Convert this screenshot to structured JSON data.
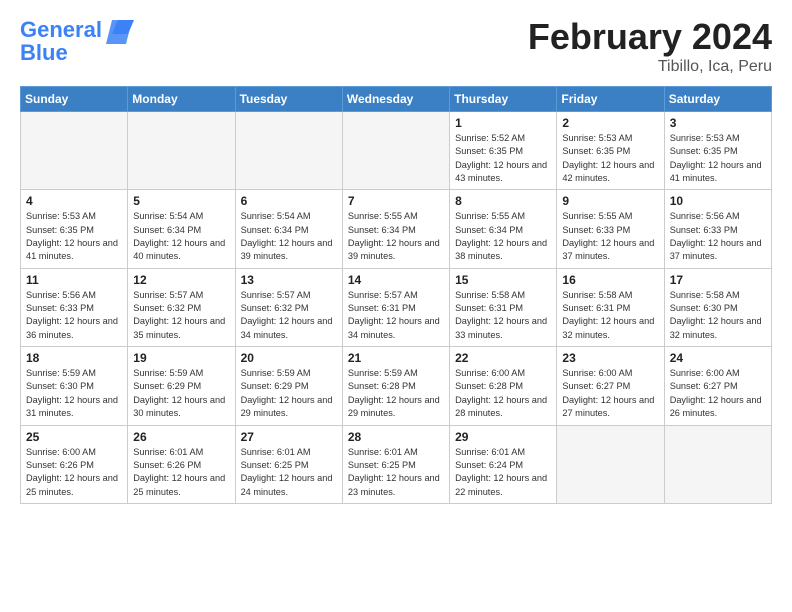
{
  "header": {
    "logo_general": "General",
    "logo_blue": "Blue",
    "month_title": "February 2024",
    "location": "Tibillo, Ica, Peru"
  },
  "days_of_week": [
    "Sunday",
    "Monday",
    "Tuesday",
    "Wednesday",
    "Thursday",
    "Friday",
    "Saturday"
  ],
  "weeks": [
    [
      {
        "num": "",
        "empty": true
      },
      {
        "num": "",
        "empty": true
      },
      {
        "num": "",
        "empty": true
      },
      {
        "num": "",
        "empty": true
      },
      {
        "num": "1",
        "sunrise": "5:52 AM",
        "sunset": "6:35 PM",
        "daylight": "12 hours and 43 minutes."
      },
      {
        "num": "2",
        "sunrise": "5:53 AM",
        "sunset": "6:35 PM",
        "daylight": "12 hours and 42 minutes."
      },
      {
        "num": "3",
        "sunrise": "5:53 AM",
        "sunset": "6:35 PM",
        "daylight": "12 hours and 41 minutes."
      }
    ],
    [
      {
        "num": "4",
        "sunrise": "5:53 AM",
        "sunset": "6:35 PM",
        "daylight": "12 hours and 41 minutes."
      },
      {
        "num": "5",
        "sunrise": "5:54 AM",
        "sunset": "6:34 PM",
        "daylight": "12 hours and 40 minutes."
      },
      {
        "num": "6",
        "sunrise": "5:54 AM",
        "sunset": "6:34 PM",
        "daylight": "12 hours and 39 minutes."
      },
      {
        "num": "7",
        "sunrise": "5:55 AM",
        "sunset": "6:34 PM",
        "daylight": "12 hours and 39 minutes."
      },
      {
        "num": "8",
        "sunrise": "5:55 AM",
        "sunset": "6:34 PM",
        "daylight": "12 hours and 38 minutes."
      },
      {
        "num": "9",
        "sunrise": "5:55 AM",
        "sunset": "6:33 PM",
        "daylight": "12 hours and 37 minutes."
      },
      {
        "num": "10",
        "sunrise": "5:56 AM",
        "sunset": "6:33 PM",
        "daylight": "12 hours and 37 minutes."
      }
    ],
    [
      {
        "num": "11",
        "sunrise": "5:56 AM",
        "sunset": "6:33 PM",
        "daylight": "12 hours and 36 minutes."
      },
      {
        "num": "12",
        "sunrise": "5:57 AM",
        "sunset": "6:32 PM",
        "daylight": "12 hours and 35 minutes."
      },
      {
        "num": "13",
        "sunrise": "5:57 AM",
        "sunset": "6:32 PM",
        "daylight": "12 hours and 34 minutes."
      },
      {
        "num": "14",
        "sunrise": "5:57 AM",
        "sunset": "6:31 PM",
        "daylight": "12 hours and 34 minutes."
      },
      {
        "num": "15",
        "sunrise": "5:58 AM",
        "sunset": "6:31 PM",
        "daylight": "12 hours and 33 minutes."
      },
      {
        "num": "16",
        "sunrise": "5:58 AM",
        "sunset": "6:31 PM",
        "daylight": "12 hours and 32 minutes."
      },
      {
        "num": "17",
        "sunrise": "5:58 AM",
        "sunset": "6:30 PM",
        "daylight": "12 hours and 32 minutes."
      }
    ],
    [
      {
        "num": "18",
        "sunrise": "5:59 AM",
        "sunset": "6:30 PM",
        "daylight": "12 hours and 31 minutes."
      },
      {
        "num": "19",
        "sunrise": "5:59 AM",
        "sunset": "6:29 PM",
        "daylight": "12 hours and 30 minutes."
      },
      {
        "num": "20",
        "sunrise": "5:59 AM",
        "sunset": "6:29 PM",
        "daylight": "12 hours and 29 minutes."
      },
      {
        "num": "21",
        "sunrise": "5:59 AM",
        "sunset": "6:28 PM",
        "daylight": "12 hours and 29 minutes."
      },
      {
        "num": "22",
        "sunrise": "6:00 AM",
        "sunset": "6:28 PM",
        "daylight": "12 hours and 28 minutes."
      },
      {
        "num": "23",
        "sunrise": "6:00 AM",
        "sunset": "6:27 PM",
        "daylight": "12 hours and 27 minutes."
      },
      {
        "num": "24",
        "sunrise": "6:00 AM",
        "sunset": "6:27 PM",
        "daylight": "12 hours and 26 minutes."
      }
    ],
    [
      {
        "num": "25",
        "sunrise": "6:00 AM",
        "sunset": "6:26 PM",
        "daylight": "12 hours and 25 minutes."
      },
      {
        "num": "26",
        "sunrise": "6:01 AM",
        "sunset": "6:26 PM",
        "daylight": "12 hours and 25 minutes."
      },
      {
        "num": "27",
        "sunrise": "6:01 AM",
        "sunset": "6:25 PM",
        "daylight": "12 hours and 24 minutes."
      },
      {
        "num": "28",
        "sunrise": "6:01 AM",
        "sunset": "6:25 PM",
        "daylight": "12 hours and 23 minutes."
      },
      {
        "num": "29",
        "sunrise": "6:01 AM",
        "sunset": "6:24 PM",
        "daylight": "12 hours and 22 minutes."
      },
      {
        "num": "",
        "empty": true
      },
      {
        "num": "",
        "empty": true
      }
    ]
  ]
}
